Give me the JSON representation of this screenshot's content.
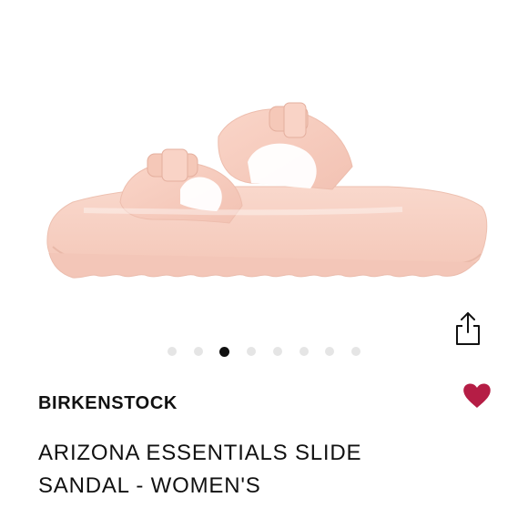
{
  "product": {
    "brand": "BIRKENSTOCK",
    "title": "ARIZONA ESSENTIALS SLIDE SANDAL - WOMEN'S",
    "color": "#f8cdbf"
  },
  "gallery": {
    "total_images": 8,
    "active_index": 3
  },
  "actions": {
    "share_icon": "share-icon",
    "favorite_icon": "heart-icon",
    "favorite_state": "active",
    "favorite_color": "#b51d45"
  },
  "colors": {
    "dot_inactive": "#e5e5e5",
    "dot_active": "#111111",
    "text": "#111111"
  }
}
